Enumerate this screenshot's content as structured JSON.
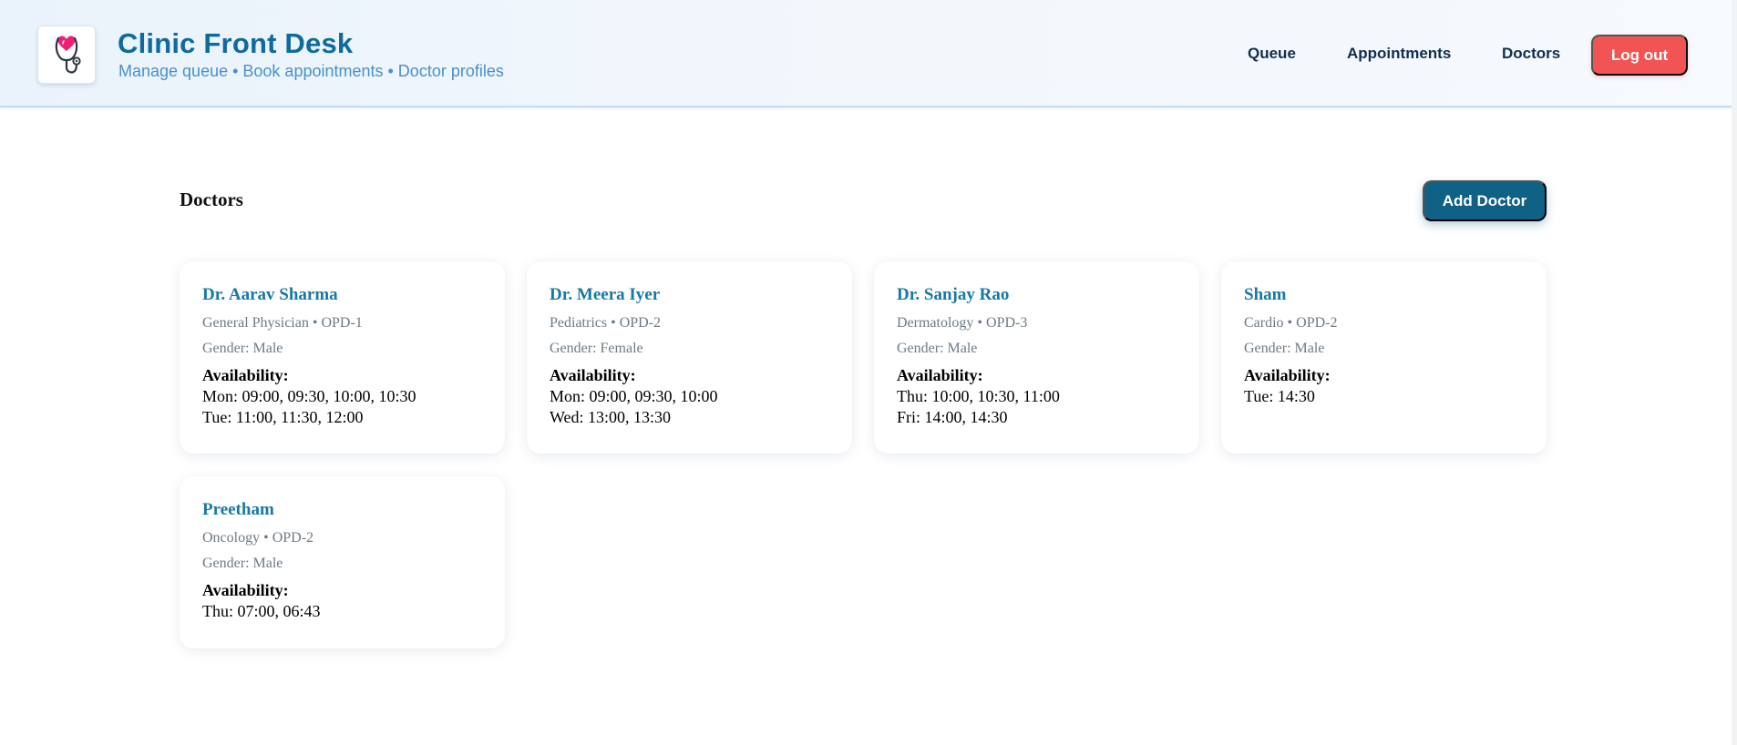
{
  "app": {
    "title": "Clinic Front Desk",
    "subtitle": "Manage queue • Book appointments • Doctor profiles",
    "logo_icon": "stethoscope-heart-icon"
  },
  "nav": {
    "queue": "Queue",
    "appointments": "Appointments",
    "doctors": "Doctors",
    "logout": "Log out"
  },
  "main": {
    "title": "Doctors",
    "add_button": "Add Doctor"
  },
  "availability_label": "Availability:",
  "doctors": [
    {
      "name": "Dr. Aarav Sharma",
      "spec": "General Physician • OPD-1",
      "gender": "Gender: Male",
      "slots": [
        "Mon: 09:00, 09:30, 10:00, 10:30",
        "Tue: 11:00, 11:30, 12:00"
      ]
    },
    {
      "name": "Dr. Meera Iyer",
      "spec": "Pediatrics • OPD-2",
      "gender": "Gender: Female",
      "slots": [
        "Mon: 09:00, 09:30, 10:00",
        "Wed: 13:00, 13:30"
      ]
    },
    {
      "name": "Dr. Sanjay Rao",
      "spec": "Dermatology • OPD-3",
      "gender": "Gender: Male",
      "slots": [
        "Thu: 10:00, 10:30, 11:00",
        "Fri: 14:00, 14:30"
      ]
    },
    {
      "name": "Sham",
      "spec": "Cardio • OPD-2",
      "gender": "Gender: Male",
      "slots": [
        "Tue: 14:30"
      ]
    },
    {
      "name": "Preetham",
      "spec": "Oncology • OPD-2",
      "gender": "Gender: Male",
      "slots": [
        "Thu: 07:00, 06:43"
      ]
    }
  ],
  "colors": {
    "brand": "#0e6aa1",
    "logout": "#f25454",
    "primary_button": "#0f6186",
    "doctor_name": "#1679a6"
  }
}
